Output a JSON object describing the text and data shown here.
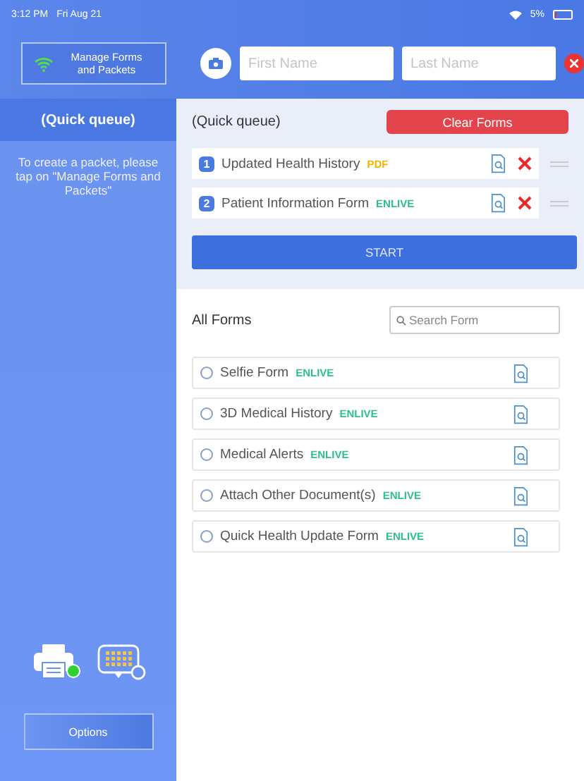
{
  "status_bar": {
    "time": "3:12 PM",
    "date": "Fri Aug 21",
    "battery": "5%"
  },
  "header": {
    "manage_button": "Manage Forms and Packets",
    "first_name": {
      "placeholder": "First Name"
    },
    "last_name": {
      "placeholder": "Last Name"
    }
  },
  "sidebar": {
    "queue_title": "(Quick queue)",
    "hint": "To create a packet, please tap on \"Manage Forms and Packets\"",
    "options_button": "Options"
  },
  "queue": {
    "title": "(Quick queue)",
    "clear_button": "Clear Forms",
    "items": [
      {
        "number": "1",
        "name": "Updated Health History",
        "tag": "PDF",
        "kind": "pdf"
      },
      {
        "number": "2",
        "name": "Patient Information Form",
        "tag": "ENLIVE",
        "kind": "enlive"
      }
    ],
    "start_button": "START"
  },
  "all_forms": {
    "title": "All Forms",
    "search": {
      "placeholder": "Search Form"
    },
    "items": [
      {
        "name": "Selfie Form",
        "tag": "ENLIVE",
        "kind": "enlive",
        "checked": false
      },
      {
        "name": "3D Medical History",
        "tag": "ENLIVE",
        "kind": "enlive",
        "checked": false
      },
      {
        "name": "Medical Alerts",
        "tag": "ENLIVE",
        "kind": "enlive",
        "checked": false
      },
      {
        "name": "Attach Other Document(s)",
        "tag": "ENLIVE",
        "kind": "enlive",
        "checked": false
      },
      {
        "name": "Quick Health Update Form",
        "tag": "ENLIVE",
        "kind": "enlive",
        "checked": false
      }
    ]
  }
}
